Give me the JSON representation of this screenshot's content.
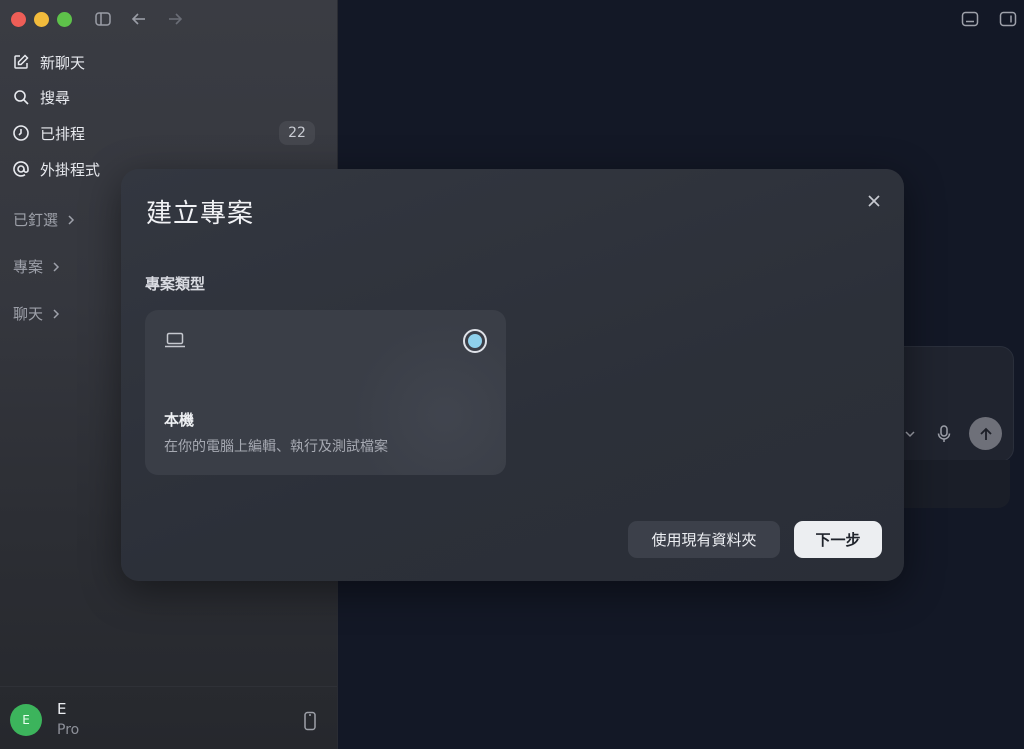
{
  "sidebar": {
    "nav": [
      {
        "label": "新聊天",
        "icon": "edit-icon"
      },
      {
        "label": "搜尋",
        "icon": "search-icon"
      },
      {
        "label": "已排程",
        "icon": "clock-icon",
        "badge": "22"
      },
      {
        "label": "外掛程式",
        "icon": "at-icon"
      }
    ],
    "sections": [
      "已釘選",
      "專案",
      "聊天"
    ],
    "user": {
      "initial": "E",
      "name": "E",
      "plan": "Pro"
    }
  },
  "modal": {
    "title": "建立專案",
    "type_label": "專案類型",
    "option": {
      "title": "本機",
      "description": "在你的電腦上編輯、執行及測試檔案",
      "selected": true
    },
    "secondary_button": "使用現有資料夾",
    "primary_button": "下一步"
  },
  "colors": {
    "accent_radio": "#8fd1ec",
    "avatar": "#3cb45c",
    "background": "#131826"
  }
}
